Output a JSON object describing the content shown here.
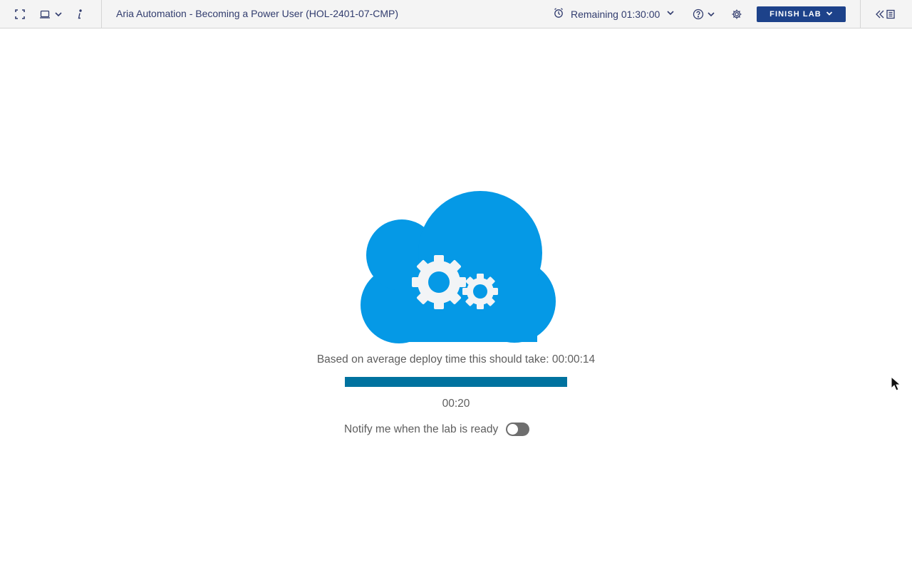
{
  "header": {
    "lab_title": "Aria Automation - Becoming a Power User (HOL-2401-07-CMP)",
    "timer_text": "Remaining 01:30:00",
    "finish_label": "FINISH LAB",
    "icons": {
      "fullscreen": "fullscreen-icon",
      "console": "console-icon",
      "info": "info-icon",
      "alarm": "alarm-clock-icon",
      "help": "help-icon",
      "settings": "gear-icon",
      "collapse": "collapse-panel-icon"
    }
  },
  "main": {
    "illustration": "cloud-gears-icon",
    "deploy_text": "Based on average deploy time this should take: 00:00:14",
    "progress_fraction": 1.0,
    "elapsed": "00:20",
    "notify_label": "Notify me when the lab is ready",
    "notify_enabled": false
  },
  "colors": {
    "cloud": "#0599e6",
    "progress": "#00729f",
    "finish_button": "#1d428a",
    "title_text": "#313c6e"
  }
}
